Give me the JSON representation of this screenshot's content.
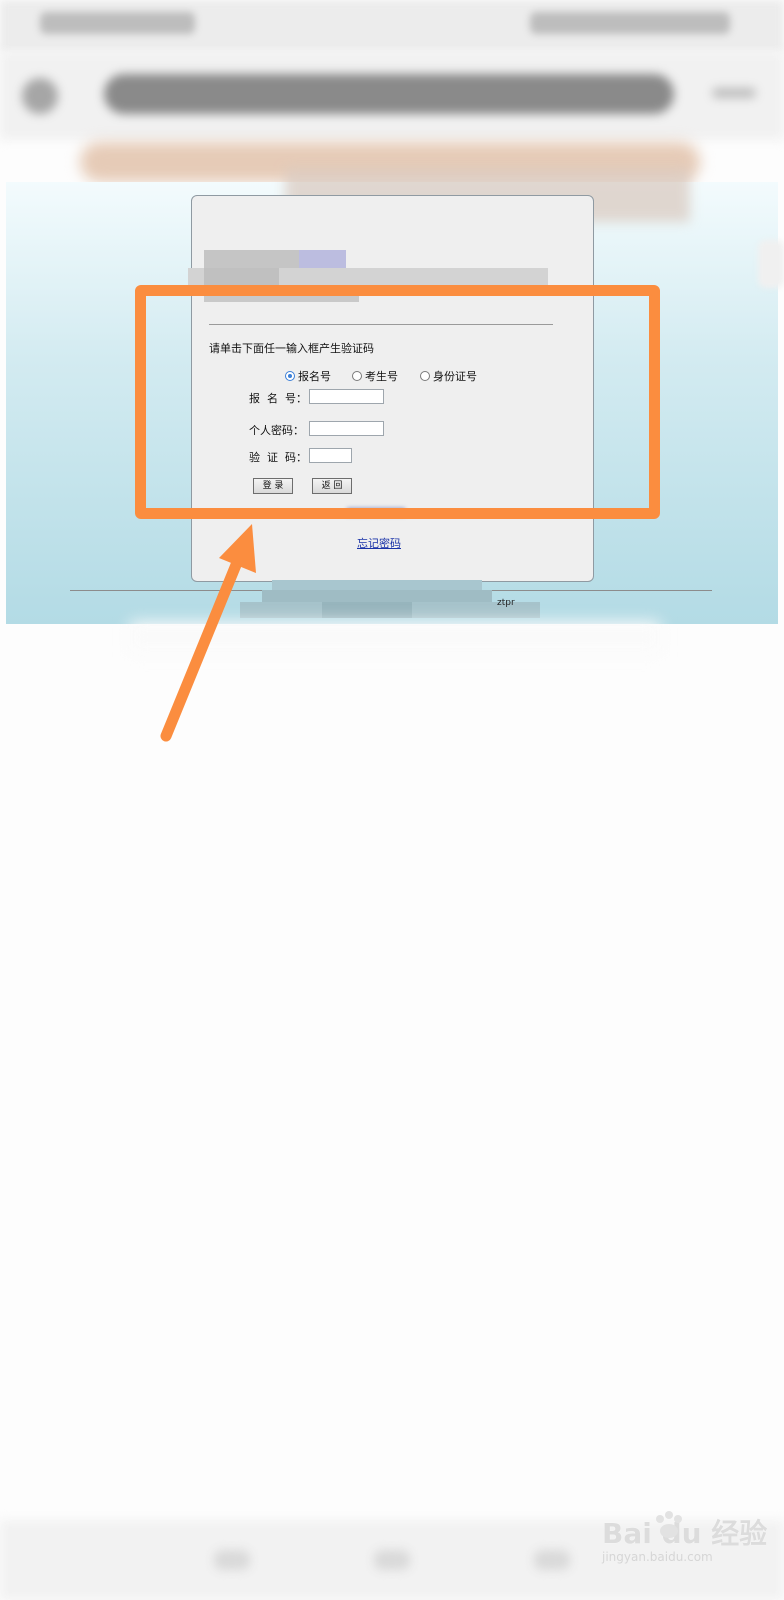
{
  "form": {
    "instruction": "请单击下面任一输入框产生验证码",
    "radio_options": [
      "报名号",
      "考生号",
      "身份证号"
    ],
    "selected_option": "报名号",
    "fields": {
      "registration_label": "报  名  号：",
      "password_label": "个人密码：",
      "captcha_label": "验  证  码："
    },
    "login_button": "登 录",
    "back_button": "返 回",
    "forgot_password_link": "忘记密码"
  },
  "footer": {
    "text": "ztpr"
  },
  "watermark": {
    "logo": "Bai du 经验",
    "url": "jingyan.baidu.com"
  },
  "colors": {
    "annotation": "#fb8d3f",
    "page_gradient_top": "#f3fbfd",
    "page_gradient_bottom": "#b3dbe5",
    "link": "#1a33a8",
    "radio_selected": "#3b7fd8"
  }
}
